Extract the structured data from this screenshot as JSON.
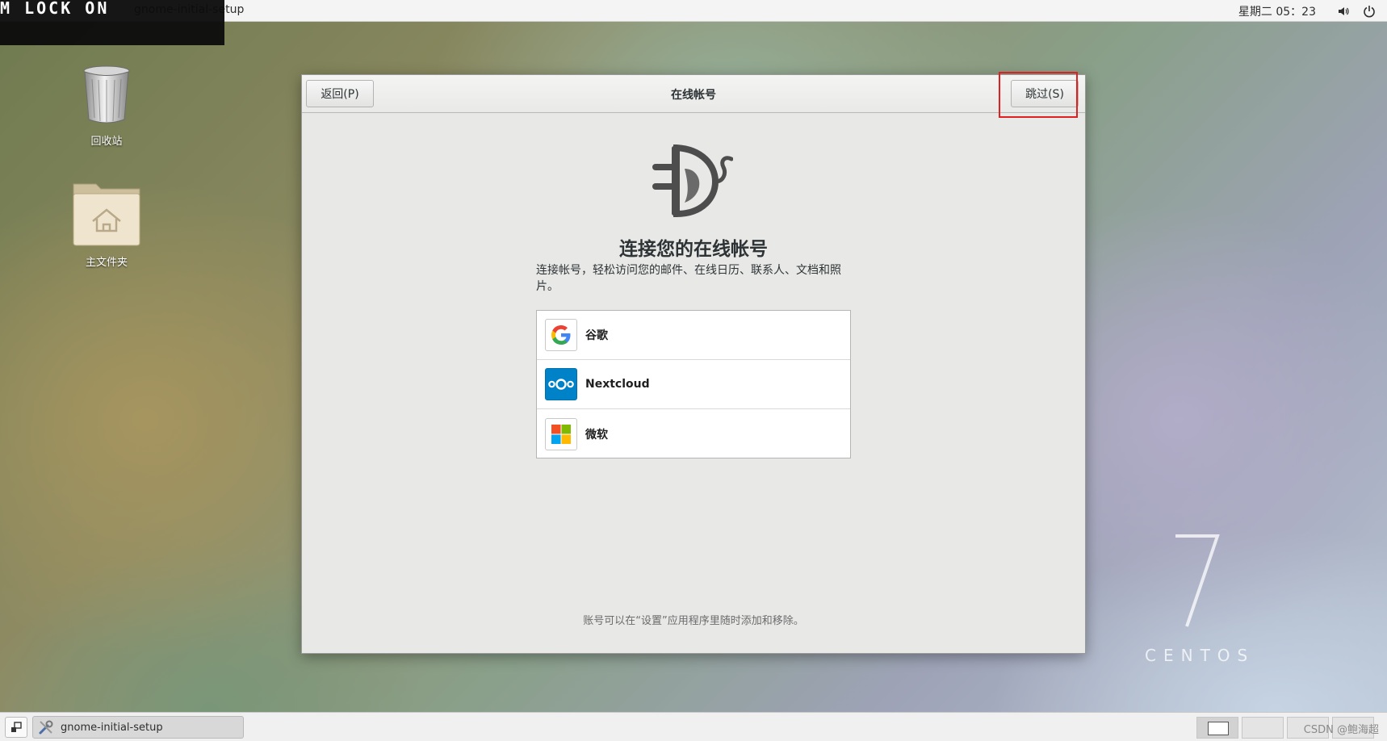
{
  "overlay": {
    "lock_text": "M LOCK ON"
  },
  "topbar": {
    "app_menu": "gnome-initial-setup",
    "clock": "星期二 05：23",
    "volume_icon": "volume-icon",
    "power_icon": "power-icon"
  },
  "desktop": {
    "icons": [
      {
        "label": "回收站",
        "icon": "trash-icon"
      },
      {
        "label": "主文件夹",
        "icon": "home-folder-icon"
      }
    ]
  },
  "window": {
    "title": "在线帐号",
    "back_label": "返回(P)",
    "skip_label": "跳过(S)",
    "heading": "连接您的在线帐号",
    "description": "连接帐号，轻松访问您的邮件、在线日历、联系人、文档和照片。",
    "providers": [
      {
        "label": "谷歌",
        "icon": "google-icon"
      },
      {
        "label": "Nextcloud",
        "icon": "nextcloud-icon"
      },
      {
        "label": "微软",
        "icon": "microsoft-icon"
      }
    ],
    "footer_note": "账号可以在“设置”应用程序里随时添加和移除。"
  },
  "watermark": {
    "seven": "7",
    "word": "CENTOS"
  },
  "taskbar": {
    "task_label": "gnome-initial-setup",
    "credit": "CSDN @鲍海超"
  },
  "colors": {
    "highlight": "#e02020",
    "nextcloud": "#0082c9"
  }
}
